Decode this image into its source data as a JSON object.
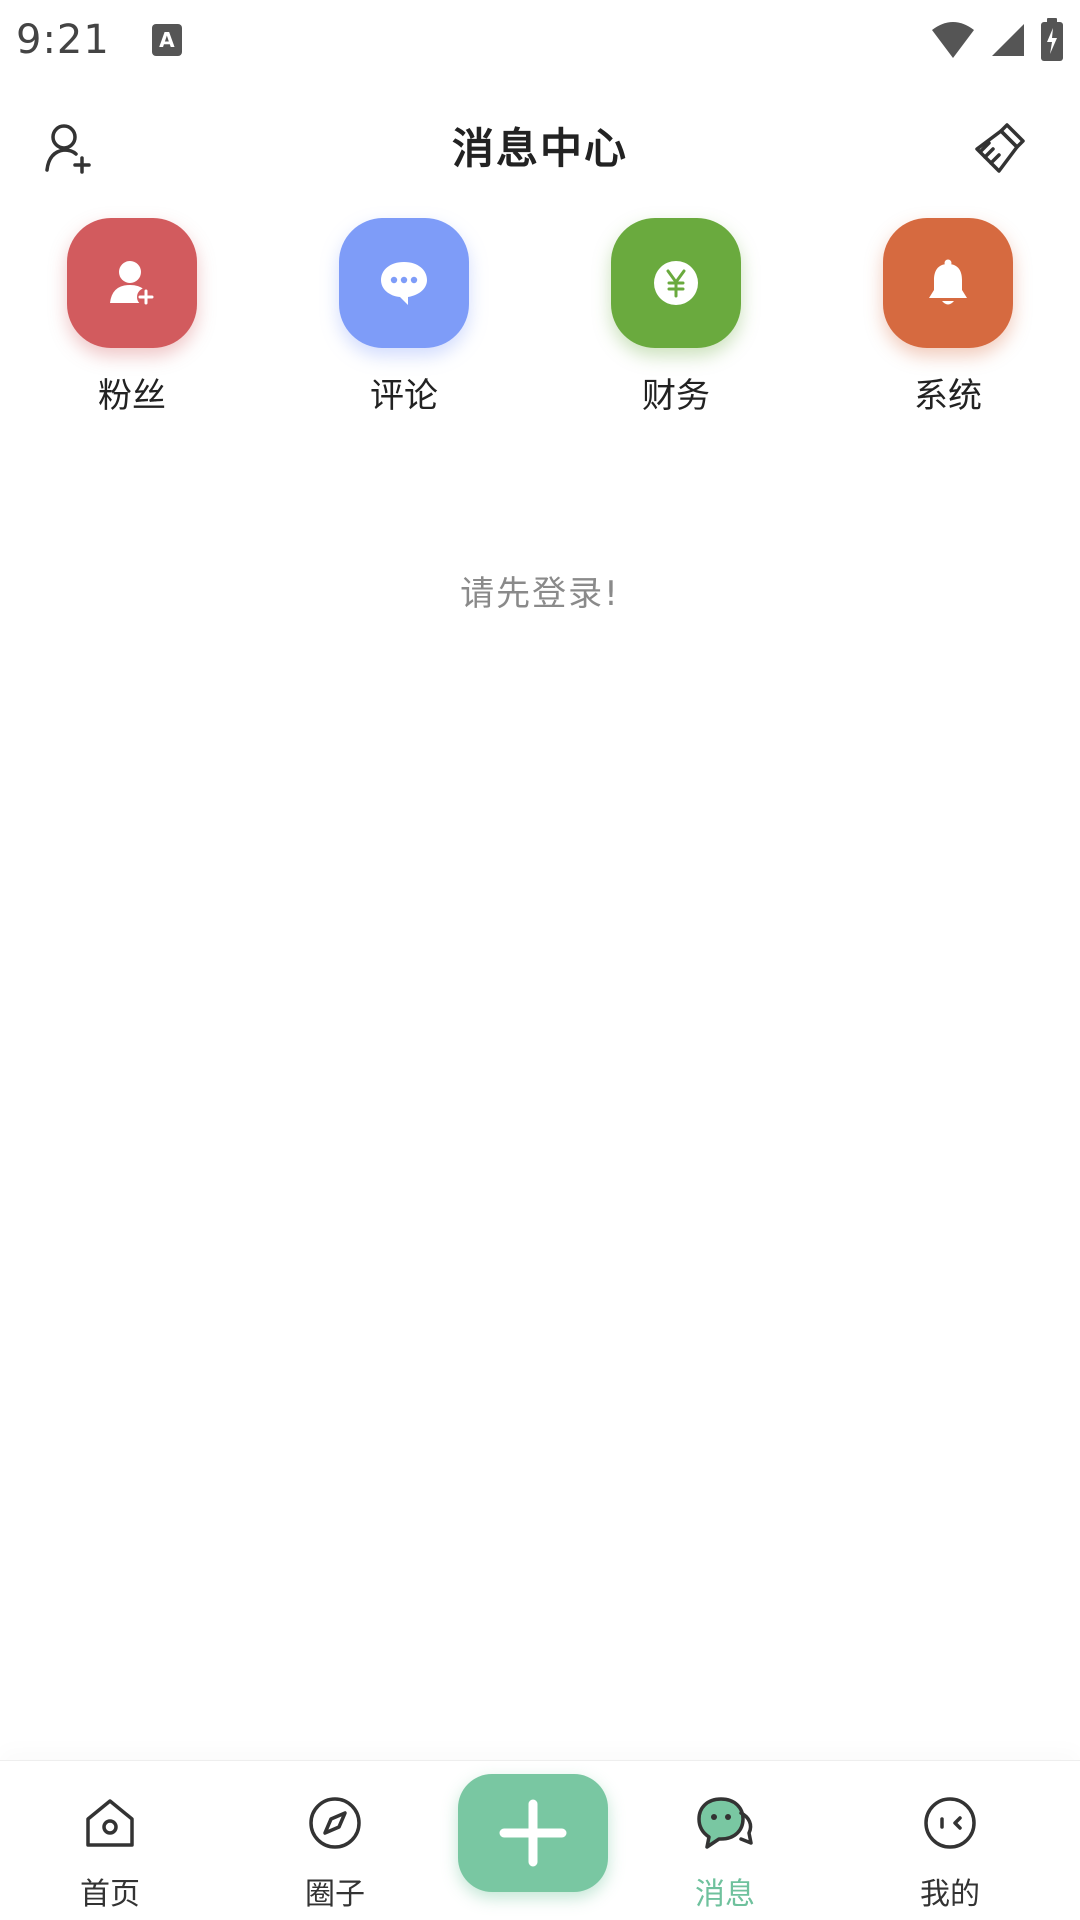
{
  "status_bar": {
    "time": "9:21",
    "notification_badge": "A"
  },
  "header": {
    "title": "消息中心",
    "left_icon": "add-user-icon",
    "right_icon": "clear-brush-icon"
  },
  "categories": [
    {
      "label": "粉丝",
      "icon": "fans-icon",
      "color": "#d25b5e"
    },
    {
      "label": "评论",
      "icon": "comment-icon",
      "color": "#7e9cf8"
    },
    {
      "label": "财务",
      "icon": "finance-icon",
      "color": "#6aaa3e"
    },
    {
      "label": "系统",
      "icon": "bell-icon",
      "color": "#d66a40"
    }
  ],
  "empty_message": "请先登录!",
  "bottom_nav": {
    "items": [
      {
        "label": "首页",
        "icon": "home-icon",
        "active": false
      },
      {
        "label": "圈子",
        "icon": "compass-icon",
        "active": false
      },
      {
        "label": "消息",
        "icon": "message-icon",
        "active": true
      },
      {
        "label": "我的",
        "icon": "profile-face-icon",
        "active": false
      }
    ],
    "fab_icon": "plus-icon",
    "active_color": "#6fc19d",
    "fab_color": "#79c7a2"
  }
}
